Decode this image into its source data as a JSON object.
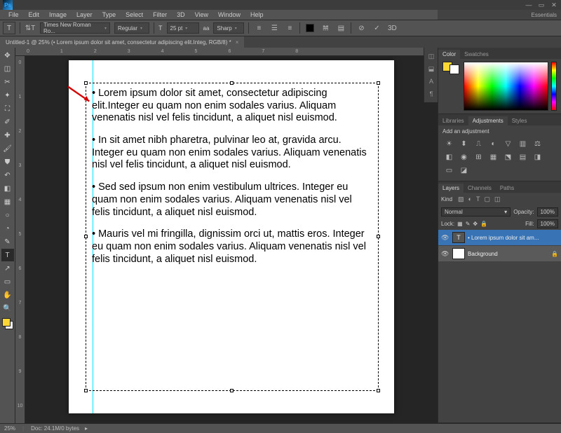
{
  "window": {
    "app": "Ps"
  },
  "menu": [
    "File",
    "Edit",
    "Image",
    "Layer",
    "Type",
    "Select",
    "Filter",
    "3D",
    "View",
    "Window",
    "Help"
  ],
  "options": {
    "font": "Times New Roman Ro...",
    "style": "Regular",
    "size_label": "T",
    "size": "25 pt",
    "aa_label": "aa",
    "aa": "Sharp"
  },
  "doc_tab": "Untitled-1 @ 25% (• Lorem ipsum dolor sit amet, consectetur adipiscing elit.Integ, RGB/8) *",
  "ruler_h": [
    "0",
    "1",
    "2",
    "3",
    "4",
    "5",
    "6",
    "7",
    "8"
  ],
  "ruler_v": [
    "0",
    "1",
    "2",
    "3",
    "4",
    "5",
    "6",
    "7",
    "8",
    "9",
    "10"
  ],
  "paragraphs": [
    "• Lorem ipsum dolor sit amet, consectetur adipiscing elit.Integer eu quam non enim sodales varius. Ali­quam venenatis nisl vel felis tincidunt, a aliquet nisl euismod.",
    "• In sit amet nibh pharetra, pulvinar leo at, gravida arcu. Integer eu quam non enim sodales varius. Ali­quam venenatis nisl vel felis tincidunt, a aliquet nisl euismod.",
    "• Sed sed ipsum non enim vestibulum ultrices. Inte­ger eu quam non enim sodales varius. Aliquam venenatis nisl vel felis tincidunt, a aliquet nisl euis­mod.",
    "• Mauris vel mi fringilla, dignissim orci ut, mattis eros. Integer eu quam non enim sodales varius. Ali­quam venenatis nisl vel felis tincidunt, a aliquet nisl euismod."
  ],
  "workspace_label": "Essentials",
  "panels": {
    "color": {
      "tabs": [
        "Color",
        "Swatches"
      ]
    },
    "adjustments": {
      "tabs": [
        "Libraries",
        "Adjustments",
        "Styles"
      ],
      "label": "Add an adjustment"
    },
    "layers": {
      "tabs": [
        "Layers",
        "Channels",
        "Paths"
      ],
      "kind_label": "Kind",
      "blend_mode": "Normal",
      "opacity_label": "Opacity:",
      "opacity": "100%",
      "lock_label": "Lock:",
      "fill_label": "Fill:",
      "fill": "100%",
      "items": [
        {
          "name": "• Lorem ipsum dolor sit am...",
          "type": "T",
          "selected": true
        },
        {
          "name": "Background",
          "type": "bg",
          "locked": true
        }
      ]
    }
  },
  "status": {
    "zoom": "25%",
    "doc": "Doc: 24.1M/0 bytes"
  }
}
